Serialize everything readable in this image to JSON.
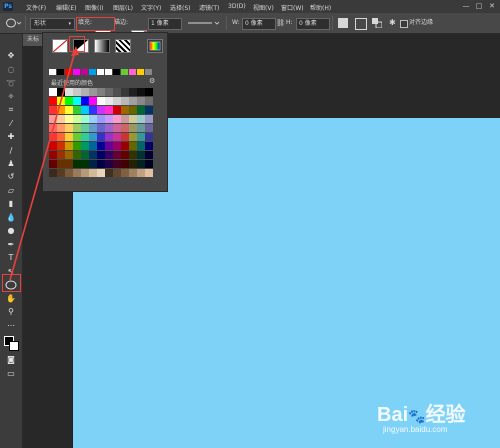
{
  "app": {
    "logo": "Ps"
  },
  "menu": [
    "文件(F)",
    "编辑(E)",
    "图像(I)",
    "图层(L)",
    "文字(Y)",
    "选择(S)",
    "滤镜(T)",
    "3D(D)",
    "视图(V)",
    "窗口(W)",
    "帮助(H)"
  ],
  "window_controls": [
    "—",
    "□",
    "✕"
  ],
  "options": {
    "shape_mode": "形状",
    "fill_label": "填充:",
    "stroke_label": "描边:",
    "stroke_width": "1 像素",
    "w_label": "W:",
    "w_value": "0 像素",
    "h_label": "H:",
    "h_value": "0 像素",
    "align_edges": "对齐边缘"
  },
  "document": {
    "tab_label": "未标"
  },
  "fill_popup": {
    "recent_colors_label": "最近使用的颜色",
    "fill_types": [
      "no-color-icon",
      "solid-color-icon",
      "gradient-icon",
      "pattern-icon",
      "color-picker-icon"
    ]
  },
  "swatches": {
    "recent": [
      "#ffffff",
      "#000000",
      "#ff0000",
      "#ff00ff",
      "#c80096",
      "#00a0e6",
      "#ffffff",
      "#ffffff",
      "#000000",
      "#66cc33",
      "#ff66cc",
      "#ffcc00",
      "#888888"
    ],
    "grid": [
      [
        "#ffffff",
        "#000000",
        "#e0e0e0",
        "#c8c8c8",
        "#b0b0b0",
        "#989898",
        "#808080",
        "#686868",
        "#505050",
        "#383838",
        "#202020",
        "#101010",
        "#000000"
      ],
      [
        "#ff0000",
        "#ffff00",
        "#00ff00",
        "#00ffff",
        "#0000ff",
        "#ff00ff",
        "#ffffff",
        "#e8e8e8",
        "#d0d0d0",
        "#b8b8b8",
        "#a0a0a0",
        "#888888",
        "#707070"
      ],
      [
        "#ff3030",
        "#ff9900",
        "#ffff33",
        "#33cc33",
        "#00ccff",
        "#3333ff",
        "#cc33ff",
        "#ff33cc",
        "#cc0000",
        "#996600",
        "#666600",
        "#006633",
        "#003366"
      ],
      [
        "#ff9999",
        "#ffcc99",
        "#ffff99",
        "#ccff99",
        "#99ffcc",
        "#99ccff",
        "#9999ff",
        "#cc99ff",
        "#ff99cc",
        "#cc9999",
        "#cccc99",
        "#99cccc",
        "#9999cc"
      ],
      [
        "#ff6666",
        "#ff9966",
        "#ffcc66",
        "#99cc66",
        "#66cc99",
        "#6699cc",
        "#6666cc",
        "#9966cc",
        "#cc6699",
        "#cc6666",
        "#999966",
        "#669999",
        "#666699"
      ],
      [
        "#ff3333",
        "#ff6633",
        "#ffcc33",
        "#66cc33",
        "#33cc99",
        "#3399cc",
        "#3333cc",
        "#9933cc",
        "#cc3399",
        "#cc3333",
        "#999933",
        "#339999",
        "#333399"
      ],
      [
        "#cc0000",
        "#cc3300",
        "#cc9900",
        "#339900",
        "#009966",
        "#006699",
        "#000099",
        "#660099",
        "#990066",
        "#990000",
        "#666600",
        "#006666",
        "#000066"
      ],
      [
        "#990000",
        "#993300",
        "#996600",
        "#336600",
        "#006633",
        "#003366",
        "#000066",
        "#330066",
        "#660033",
        "#660000",
        "#333300",
        "#003333",
        "#000033"
      ],
      [
        "#660000",
        "#663300",
        "#663300",
        "#003300",
        "#003300",
        "#002244",
        "#000044",
        "#220044",
        "#440022",
        "#440000",
        "#222200",
        "#002222",
        "#000022"
      ],
      [
        "#3a2a20",
        "#5a3a20",
        "#7a5a3a",
        "#9a7a5a",
        "#b89a7a",
        "#d4b89a",
        "#e8d4b8",
        "#403020",
        "#604830",
        "#806040",
        "#a08060",
        "#c0a080",
        "#e0c0a0"
      ]
    ]
  }
}
